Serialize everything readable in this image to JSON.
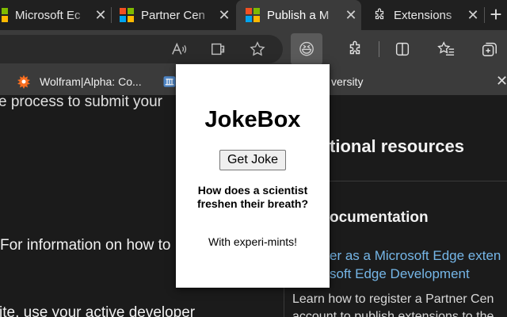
{
  "tabs": [
    {
      "title": "Microsoft Ec",
      "favicon": "microsoft-logo-icon",
      "close": "✕"
    },
    {
      "title": "Partner Cen",
      "favicon": "microsoft-logo-icon",
      "close": "✕"
    },
    {
      "title": "Publish a M",
      "favicon": "microsoft-logo-icon",
      "close": "✕",
      "active": true
    },
    {
      "title": "Extensions",
      "favicon": "extensions-puzzle-icon",
      "close": "✕"
    }
  ],
  "new_tab": "+",
  "toolbar": {
    "icons": [
      "read-aloud-icon",
      "immersive-reader-icon",
      "favorite-star-icon",
      "jokebox-extension-icon",
      "extensions-icon",
      "split-screen-icon",
      "favorites-icon",
      "collections-icon"
    ],
    "emoji": "😆"
  },
  "favorites": [
    {
      "label": "Wolfram|Alpha: Co...",
      "icon": "wolfram-icon"
    },
    {
      "label": "versity",
      "icon": "university-icon"
    }
  ],
  "favbar_close": "✕",
  "page": {
    "left_line1": "e process to submit your",
    "left_line2": "For information on how to",
    "left_line3": "ite, use your active developer",
    "right_heading": "tional resources",
    "right_subheading": "ocumentation",
    "right_link1": "er as a Microsoft Edge exten",
    "right_link2": "soft Edge Development",
    "right_para1": "Learn how to register a Partner Cen",
    "right_para2": "account to publish extensions to the"
  },
  "popup": {
    "title": "JokeBox",
    "button_label": "Get Joke",
    "question": "How does a scientist freshen their breath?",
    "answer": "With experi-mints!"
  },
  "colors": {
    "ms_red": "#f25022",
    "ms_green": "#7fba00",
    "ms_blue": "#00a4ef",
    "ms_yellow": "#ffb900",
    "link_blue": "#75b6e7",
    "wolfram_orange": "#f96e1f"
  }
}
